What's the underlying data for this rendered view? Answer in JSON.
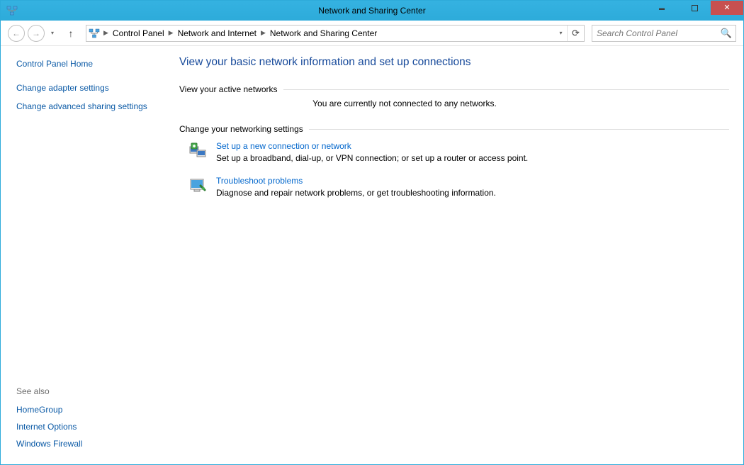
{
  "window": {
    "title": "Network and Sharing Center"
  },
  "breadcrumb": {
    "items": [
      "Control Panel",
      "Network and Internet",
      "Network and Sharing Center"
    ]
  },
  "search": {
    "placeholder": "Search Control Panel"
  },
  "sidebar": {
    "home": "Control Panel Home",
    "tasks": [
      "Change adapter settings",
      "Change advanced sharing settings"
    ],
    "seealso_header": "See also",
    "seealso": [
      "HomeGroup",
      "Internet Options",
      "Windows Firewall"
    ]
  },
  "main": {
    "heading": "View your basic network information and set up connections",
    "active_networks_label": "View your active networks",
    "no_network_msg": "You are currently not connected to any networks.",
    "change_settings_label": "Change your networking settings",
    "settings": [
      {
        "link": "Set up a new connection or network",
        "desc": "Set up a broadband, dial-up, or VPN connection; or set up a router or access point."
      },
      {
        "link": "Troubleshoot problems",
        "desc": "Diagnose and repair network problems, or get troubleshooting information."
      }
    ]
  }
}
